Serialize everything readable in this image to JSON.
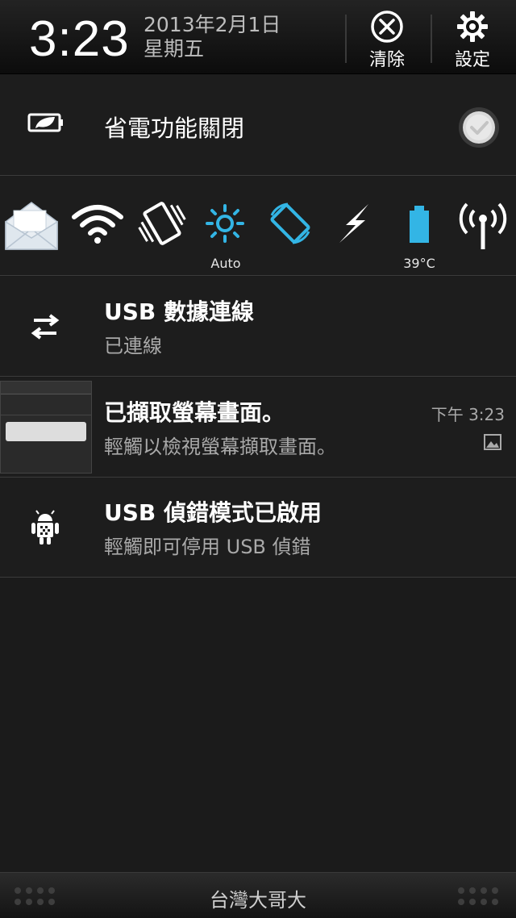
{
  "header": {
    "time": "3:23",
    "date": "2013年2月1日",
    "weekday": "星期五",
    "clear_label": "清除",
    "settings_label": "設定"
  },
  "power_saver": {
    "label": "省電功能關閉",
    "checked": true
  },
  "quick_settings": {
    "items": [
      {
        "icon": "mail-icon",
        "caption": ""
      },
      {
        "icon": "wifi-icon",
        "caption": ""
      },
      {
        "icon": "vibrate-icon",
        "caption": ""
      },
      {
        "icon": "brightness-icon",
        "caption": "Auto"
      },
      {
        "icon": "auto-rotate-icon",
        "caption": ""
      },
      {
        "icon": "flash-icon",
        "caption": ""
      },
      {
        "icon": "battery-icon",
        "caption": "39°C"
      },
      {
        "icon": "hotspot-icon",
        "caption": ""
      }
    ]
  },
  "notifications": [
    {
      "title": "USB 數據連線",
      "subtitle": "已連線",
      "icon": "usb-transfer-icon"
    },
    {
      "title": "已擷取螢幕畫面。",
      "subtitle": "輕觸以檢視螢幕擷取畫面。",
      "time": "下午 3:23",
      "icon": "screenshot-thumbnail"
    },
    {
      "title": "USB 偵錯模式已啟用",
      "subtitle": "輕觸即可停用 USB 偵錯",
      "icon": "android-debug-icon"
    }
  ],
  "footer": {
    "carrier": "台灣大哥大"
  },
  "colors": {
    "accent_blue": "#33b5e5",
    "background": "#1b1b1b",
    "divider": "#3b3b3b"
  }
}
